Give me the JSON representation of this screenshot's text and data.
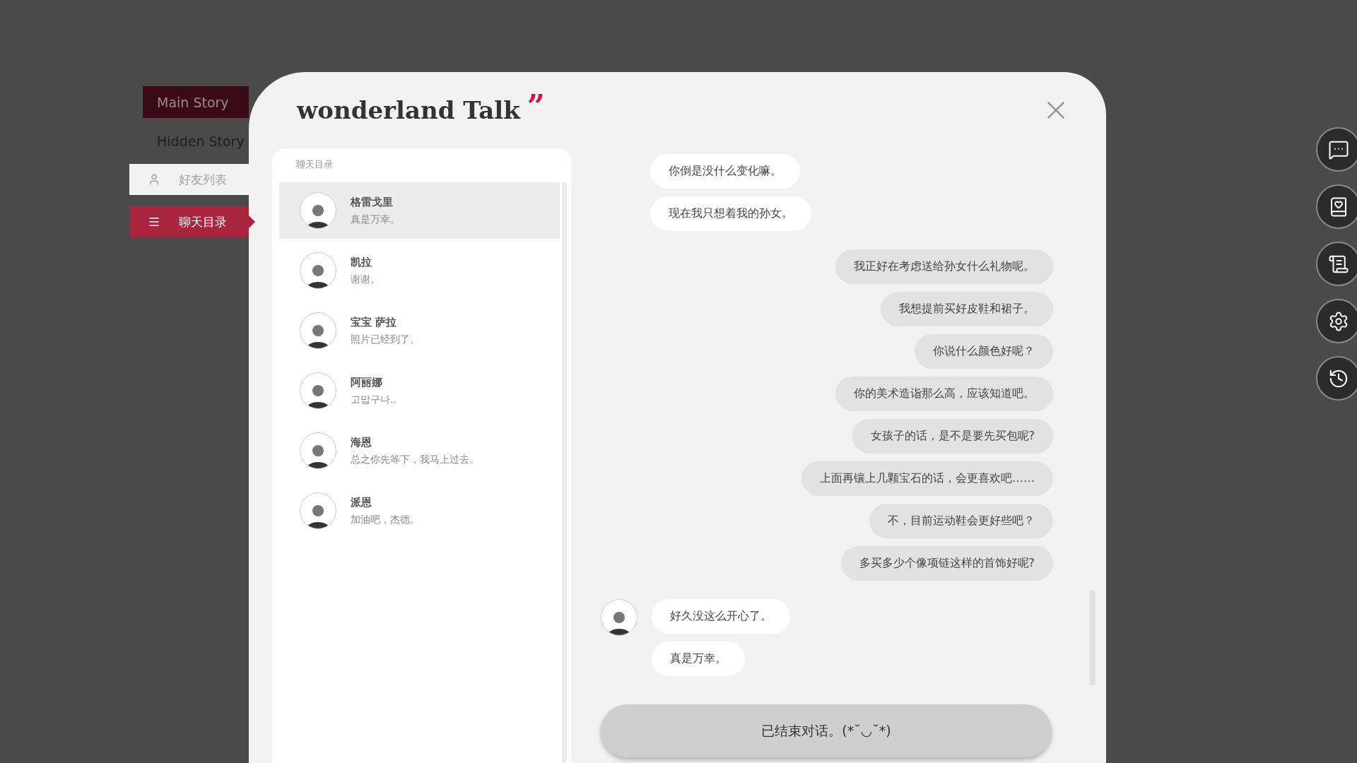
{
  "story_tabs": [
    {
      "label": "Main Story",
      "selected": true
    },
    {
      "label": "Hidden Story",
      "selected": false
    }
  ],
  "menu": [
    {
      "label": "好友列表",
      "kind": "person",
      "selected": false
    },
    {
      "label": "聊天目录",
      "kind": "list",
      "selected": true
    }
  ],
  "window": {
    "title": "wonderland Talk",
    "title_mark": "”"
  },
  "chat_list": {
    "heading": "聊天目录",
    "items": [
      {
        "name": "格雷戈里",
        "preview": "真是万幸。",
        "selected": true
      },
      {
        "name": "凯拉",
        "preview": "谢谢。",
        "selected": false
      },
      {
        "name": "宝宝 萨拉",
        "preview": "照片已经到了。",
        "selected": false
      },
      {
        "name": "阿丽娜",
        "preview": "고맙구나..",
        "selected": false
      },
      {
        "name": "海恩",
        "preview": "总之你先等下，我马上过去。",
        "selected": false
      },
      {
        "name": "派恩",
        "preview": "加油吧，杰德。",
        "selected": false
      }
    ]
  },
  "conversation": {
    "groups": [
      {
        "kind": "received",
        "show_avatar": false,
        "messages": [
          "你倒是没什么变化嘛。",
          "现在我只想着我的孙女。"
        ]
      },
      {
        "kind": "sent",
        "show_avatar": false,
        "messages": [
          "我正好在考虑送给孙女什么礼物呢。",
          "我想提前买好皮鞋和裙子。",
          "你说什么颜色好呢？",
          "你的美术造诣那么高，应该知道吧。",
          "女孩子的话，是不是要先买包呢?",
          "上面再镶上几颗宝石的话，会更喜欢吧……",
          "不，目前运动鞋会更好些吧？",
          "多买多少个像项链这样的首饰好呢?"
        ]
      },
      {
        "kind": "received",
        "show_avatar": true,
        "messages": [
          "好久没这么开心了。",
          "真是万幸。"
        ]
      }
    ],
    "end_button": "已结束对话。(*˘◡˘*)"
  },
  "side_buttons": [
    {
      "kind": "chat"
    },
    {
      "kind": "book"
    },
    {
      "kind": "scroll"
    },
    {
      "kind": "settings"
    },
    {
      "kind": "history"
    }
  ]
}
